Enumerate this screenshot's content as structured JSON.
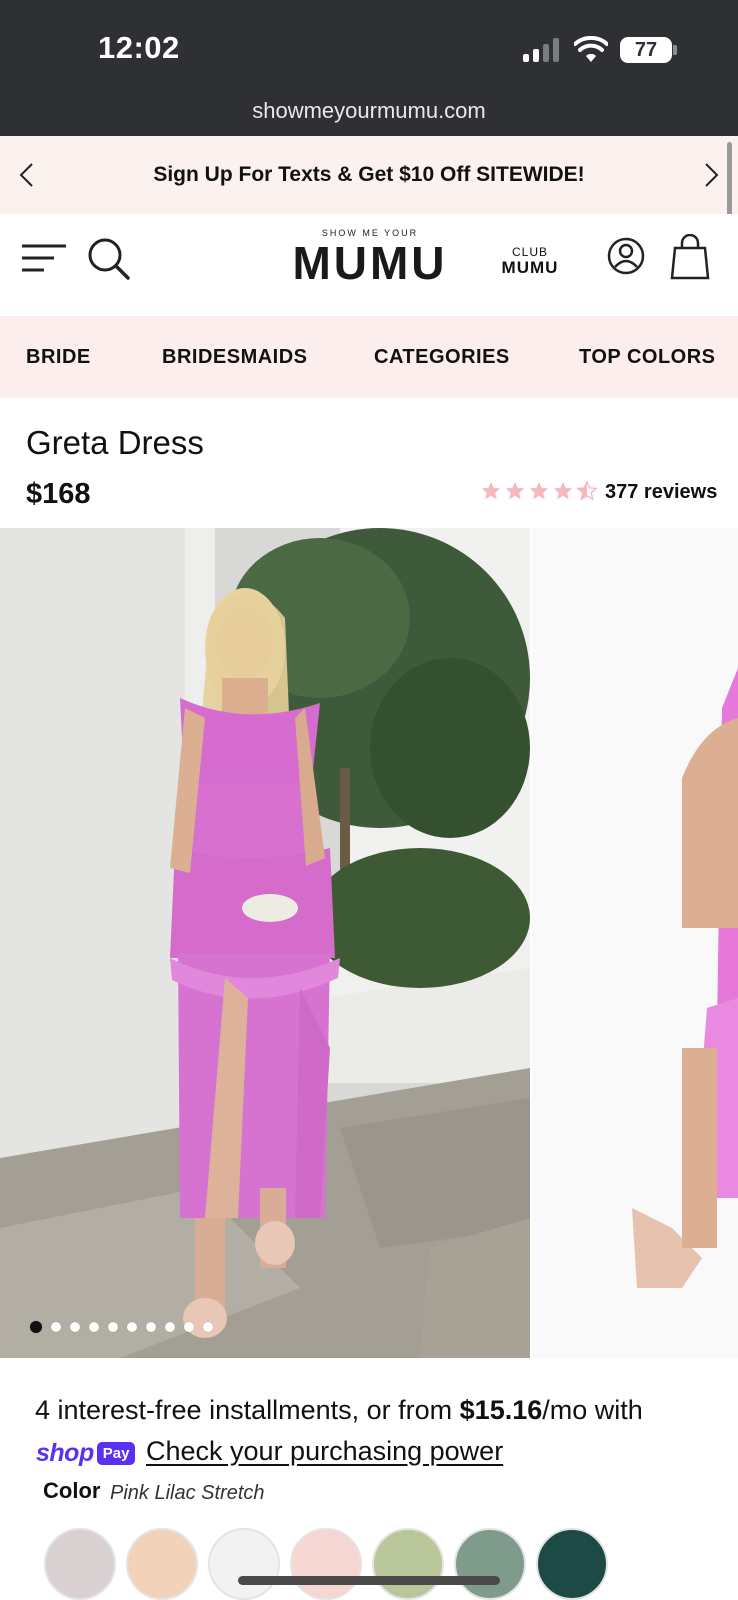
{
  "status": {
    "time": "12:02",
    "battery": "77"
  },
  "browser": {
    "url": "showmeyourmumu.com"
  },
  "announcement": {
    "text": "Sign Up For Texts & Get $10 Off SITEWIDE!"
  },
  "header": {
    "logo_small": "SHOW ME YOUR",
    "logo_main": "MUMU",
    "club_small": "CLUB",
    "club_main": "MUMU"
  },
  "nav": {
    "items": [
      "BRIDE",
      "BRIDESMAIDS",
      "CATEGORIES",
      "TOP COLORS"
    ]
  },
  "product": {
    "title": "Greta Dress",
    "price": "$168",
    "rating": 4.5,
    "reviews": "377 reviews"
  },
  "gallery": {
    "image_count": 10,
    "active_index": 0
  },
  "payment": {
    "prefix": "4 interest-free installments, or from ",
    "amount": "$15.16",
    "suffix": "/mo with",
    "shop_word": "shop",
    "pay_badge": "Pay",
    "link": "Check your purchasing power"
  },
  "color": {
    "label": "Color",
    "selected": "Pink Lilac Stretch",
    "swatches": [
      "#d9d0d2",
      "#f2d2b8",
      "#f2f2f2",
      "#f5d6d3",
      "#b9c79b",
      "#7e9b8c",
      "#1d4a45"
    ]
  },
  "colors": {
    "accent_pink": "#fbeeec",
    "shop_pay": "#5a31f4",
    "star": "#f7b7bd"
  }
}
